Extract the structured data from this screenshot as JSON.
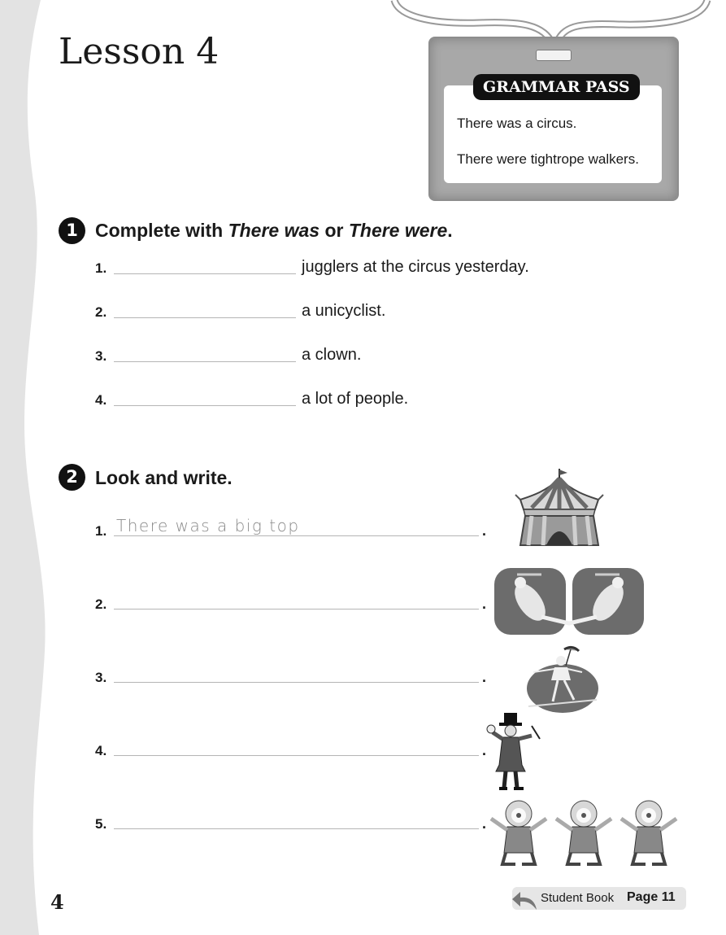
{
  "lesson": {
    "title": "Lesson 4",
    "page_number": "4"
  },
  "grammar_pass": {
    "header": "GRAMMAR PASS",
    "lines": [
      "There was a circus.",
      "There were tightrope walkers."
    ]
  },
  "exercise1": {
    "number": "1",
    "instruction_pre": "Complete with ",
    "instruction_em1": "There was",
    "instruction_mid": " or ",
    "instruction_em2": "There were",
    "instruction_post": ".",
    "items": [
      {
        "num": "1.",
        "text": "jugglers at the circus yesterday."
      },
      {
        "num": "2.",
        "text": "a unicyclist."
      },
      {
        "num": "3.",
        "text": "a clown."
      },
      {
        "num": "4.",
        "text": "a lot of people."
      }
    ]
  },
  "exercise2": {
    "number": "2",
    "instruction": "Look and write.",
    "example_answer": "There was a big top",
    "items": [
      {
        "num": "1.",
        "picture": "big-top-tent"
      },
      {
        "num": "2.",
        "picture": "trapeze-artists"
      },
      {
        "num": "3.",
        "picture": "tightrope-walker"
      },
      {
        "num": "4.",
        "picture": "ringmaster"
      },
      {
        "num": "5.",
        "picture": "clowns"
      }
    ],
    "period": "."
  },
  "reference": {
    "book": "Student Book",
    "page": "Page 11"
  },
  "colors": {
    "ink": "#1a1a1a",
    "margin_gray": "#e3e3e3",
    "pass_gray": "#a8a8a8"
  }
}
